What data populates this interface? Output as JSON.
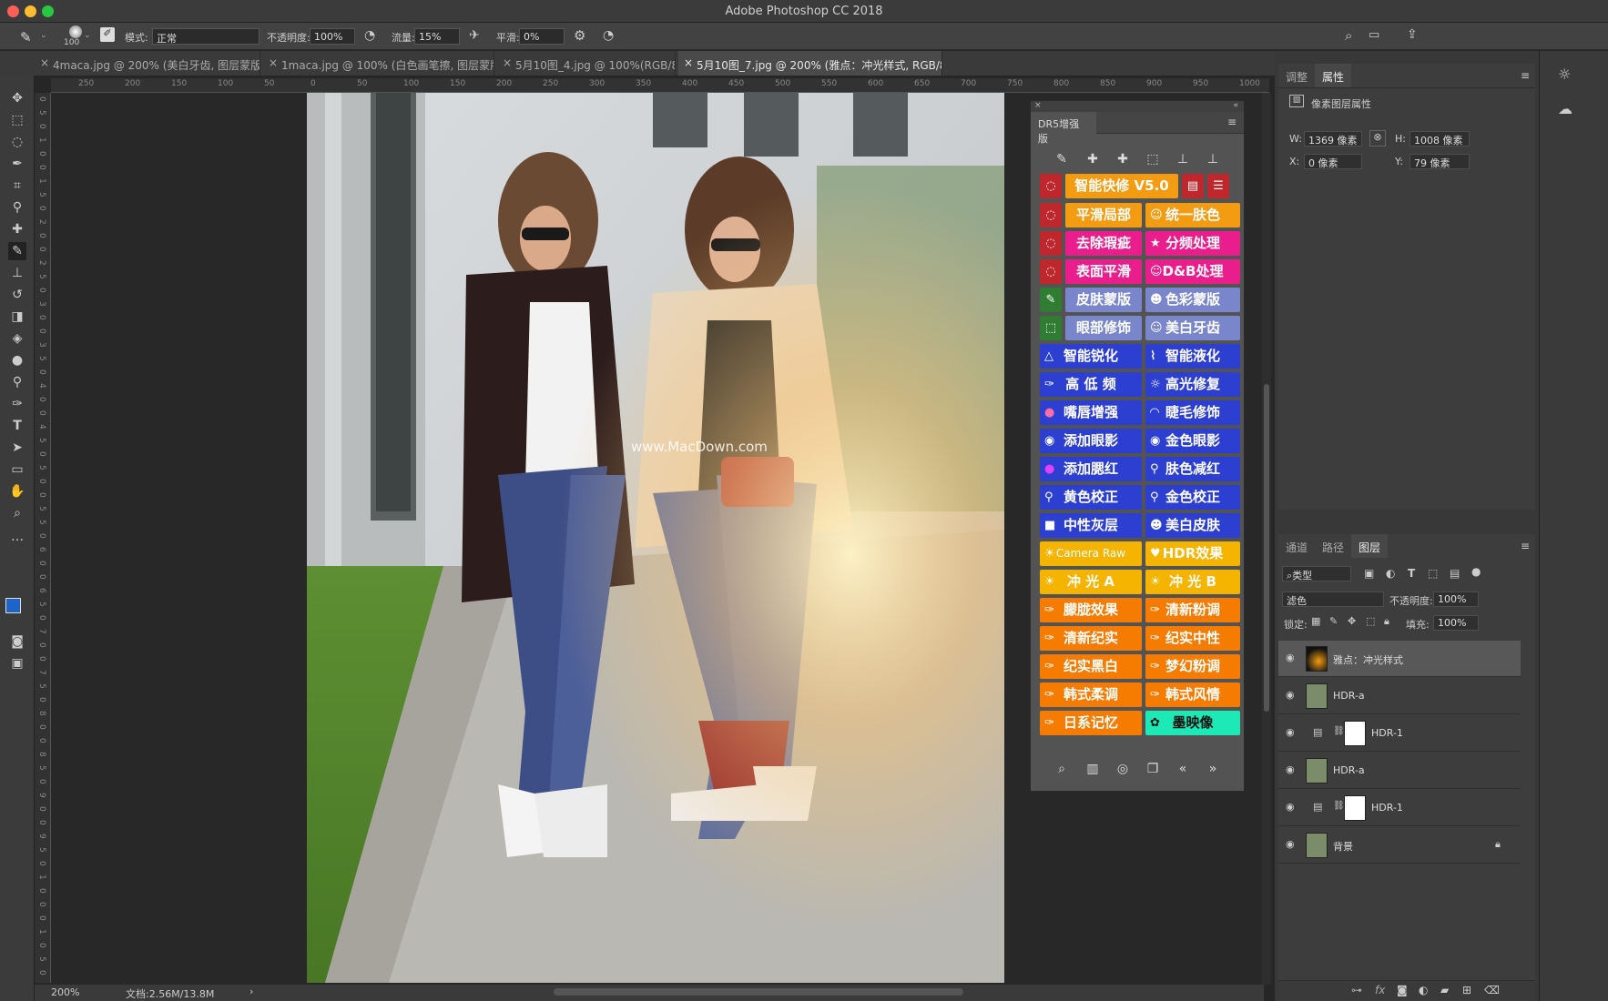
{
  "app": {
    "title": "Adobe Photoshop CC 2018"
  },
  "options_bar": {
    "brush_size": "100",
    "mode_label": "模式:",
    "mode_value": "正常",
    "opacity_label": "不透明度:",
    "opacity_value": "100%",
    "flow_label": "流量:",
    "flow_value": "15%",
    "smooth_label": "平滑:",
    "smooth_value": "0%"
  },
  "tabs": [
    {
      "label": "4maca.jpg @ 200% (美白牙齿, 图层蒙版/8) *"
    },
    {
      "label": "1maca.jpg @ 100% (白色画笔擦, 图层蒙版/8) *"
    },
    {
      "label": "5月10图_4.jpg @ 100%(RGB/8#)"
    },
    {
      "label": "5月10图_7.jpg @ 200% (雅点：冲光样式, RGB/8#) *"
    }
  ],
  "ruler_top": [
    "250",
    "200",
    "150",
    "100",
    "50",
    "0",
    "50",
    "100",
    "150",
    "200",
    "250",
    "300",
    "350",
    "400",
    "450",
    "500",
    "550",
    "600",
    "650",
    "700",
    "750",
    "800",
    "850",
    "900",
    "950",
    "1000"
  ],
  "ruler_left": [
    "0",
    "5",
    "0",
    "1",
    "0",
    "0",
    "1",
    "5",
    "0",
    "2",
    "0",
    "0",
    "2",
    "5",
    "0",
    "3",
    "0",
    "0",
    "3",
    "5",
    "0",
    "4",
    "0",
    "0",
    "4",
    "5",
    "0",
    "5",
    "0",
    "0",
    "5",
    "5",
    "0",
    "6",
    "0",
    "0",
    "6",
    "5",
    "0",
    "7",
    "0",
    "0",
    "7",
    "5",
    "0",
    "8",
    "0",
    "0",
    "8",
    "5",
    "0",
    "9",
    "0",
    "0",
    "9",
    "5",
    "0",
    "1",
    "0",
    "0",
    "0",
    "1",
    "0",
    "5",
    "0"
  ],
  "watermark": "www.MacDown.com",
  "status": {
    "zoom": "200%",
    "doc": "文档:2.56M/13.8M"
  },
  "dr5": {
    "panel_title": "DR5增强版",
    "buttons": [
      {
        "label": "智能快修 V5.0"
      },
      {
        "label": "平滑局部"
      },
      {
        "label": "统一肤色"
      },
      {
        "label": "去除瑕疵"
      },
      {
        "label": "分频处理"
      },
      {
        "label": "表面平滑"
      },
      {
        "label": "D&B处理"
      },
      {
        "label": "皮肤蒙版"
      },
      {
        "label": "色彩蒙版"
      },
      {
        "label": "眼部修饰"
      },
      {
        "label": "美白牙齿"
      },
      {
        "label": "智能锐化"
      },
      {
        "label": "智能液化"
      },
      {
        "label": "高 低 频"
      },
      {
        "label": "高光修复"
      },
      {
        "label": "嘴唇增强"
      },
      {
        "label": "睫毛修饰"
      },
      {
        "label": "添加眼影"
      },
      {
        "label": "金色眼影"
      },
      {
        "label": "添加腮红"
      },
      {
        "label": "肤色减红"
      },
      {
        "label": "黄色校正"
      },
      {
        "label": "金色校正"
      },
      {
        "label": "中性灰层"
      },
      {
        "label": "美白皮肤"
      },
      {
        "label": "Camera Raw"
      },
      {
        "label": "HDR效果"
      },
      {
        "label": "冲 光 A"
      },
      {
        "label": "冲 光 B"
      },
      {
        "label": "朦胧效果"
      },
      {
        "label": "清新粉调"
      },
      {
        "label": "清新纪实"
      },
      {
        "label": "纪实中性"
      },
      {
        "label": "纪实黑白"
      },
      {
        "label": "梦幻粉调"
      },
      {
        "label": "韩式柔调"
      },
      {
        "label": "韩式风情"
      },
      {
        "label": "日系记忆"
      },
      {
        "label": "墨映像"
      }
    ]
  },
  "properties": {
    "tab_adjust": "调整",
    "tab_props": "属性",
    "section": "像素图层属性",
    "w_label": "W:",
    "w_value": "1369 像素",
    "h_label": "H:",
    "h_value": "1008 像素",
    "x_label": "X:",
    "x_value": "0 像素",
    "y_label": "Y:",
    "y_value": "79 像素"
  },
  "layers_panel": {
    "tab_channels": "通道",
    "tab_paths": "路径",
    "tab_layers": "图层",
    "filter_kind": "类型",
    "blend_mode": "滤色",
    "opacity_label": "不透明度:",
    "opacity_value": "100%",
    "lock_label": "锁定:",
    "fill_label": "填充:",
    "fill_value": "100%",
    "layers": [
      {
        "name": "雅点：冲光样式"
      },
      {
        "name": "HDR-a"
      },
      {
        "name": "HDR-1"
      },
      {
        "name": "HDR-a"
      },
      {
        "name": "HDR-1"
      },
      {
        "name": "背景"
      }
    ]
  }
}
